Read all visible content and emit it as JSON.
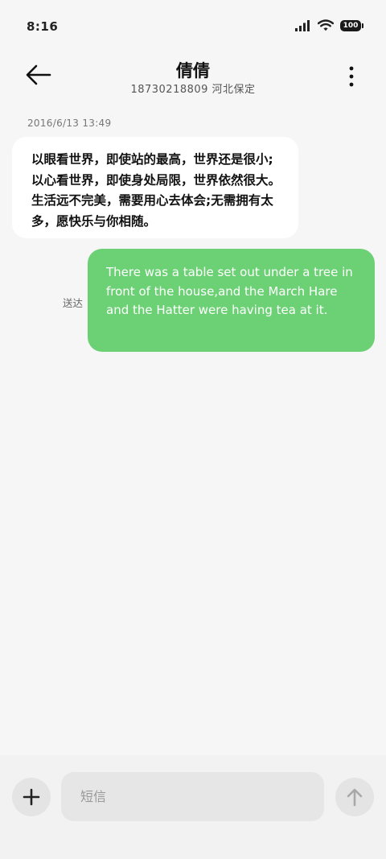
{
  "status_bar": {
    "time": "8:16",
    "battery": "100",
    "icons": [
      "signal-icon",
      "wifi-icon",
      "battery-icon"
    ]
  },
  "header": {
    "contact_name": "倩倩",
    "contact_subtitle": "18730218809 河北保定",
    "icons": [
      "back-arrow-icon",
      "more-vertical-icon"
    ]
  },
  "conversation": {
    "timestamp": "2016/6/13 13:49",
    "received_message": "以眼看世界，即使站的最高，世界还是很小;以心看世界，即使身处局限，世界依然很大。生活远不完美，需要用心去体会;无需拥有太多，愿快乐与你相随。",
    "sent_message": "There was a table set out under a tree in front of the house,and the March Hare and the Hatter were having tea at it.",
    "sent_status": "送达"
  },
  "composer": {
    "placeholder": "短信",
    "value": "",
    "icons": [
      "plus-icon",
      "send-arrow-icon"
    ]
  },
  "colors": {
    "background": "#f6f6f6",
    "sent_bubble": "#6bd174",
    "received_bubble": "#ffffff"
  }
}
